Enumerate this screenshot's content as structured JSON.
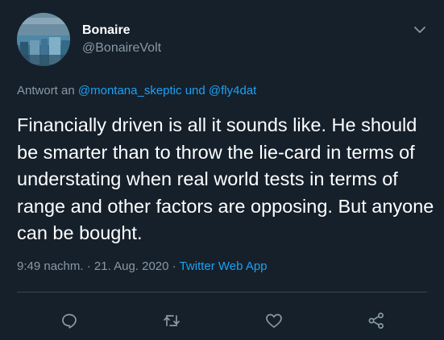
{
  "user": {
    "display_name": "Bonaire",
    "handle": "@BonaireVolt"
  },
  "reply": {
    "prefix": "Antwort an",
    "user1": "@montana_skeptic",
    "conj": "und",
    "user2": "@fly4dat"
  },
  "tweet": {
    "text": "Financially driven is all it sounds like.  He should be smarter than to throw the lie-card in terms of understating when real world tests in terms of range and other factors are opposing.  But anyone can be bought."
  },
  "meta": {
    "time": "9:49 nachm.",
    "sep1": "·",
    "date": "21. Aug. 2020",
    "sep2": "·",
    "app": "Twitter Web App"
  },
  "actions": {
    "reply_icon": "reply-icon",
    "retweet_icon": "retweet-icon",
    "like_icon": "heart-icon",
    "share_icon": "share-icon"
  },
  "colors": {
    "background": "#15202b",
    "text": "#ffffff",
    "muted": "#8899a6",
    "accent": "#1da1f2",
    "divider": "#38444d"
  }
}
